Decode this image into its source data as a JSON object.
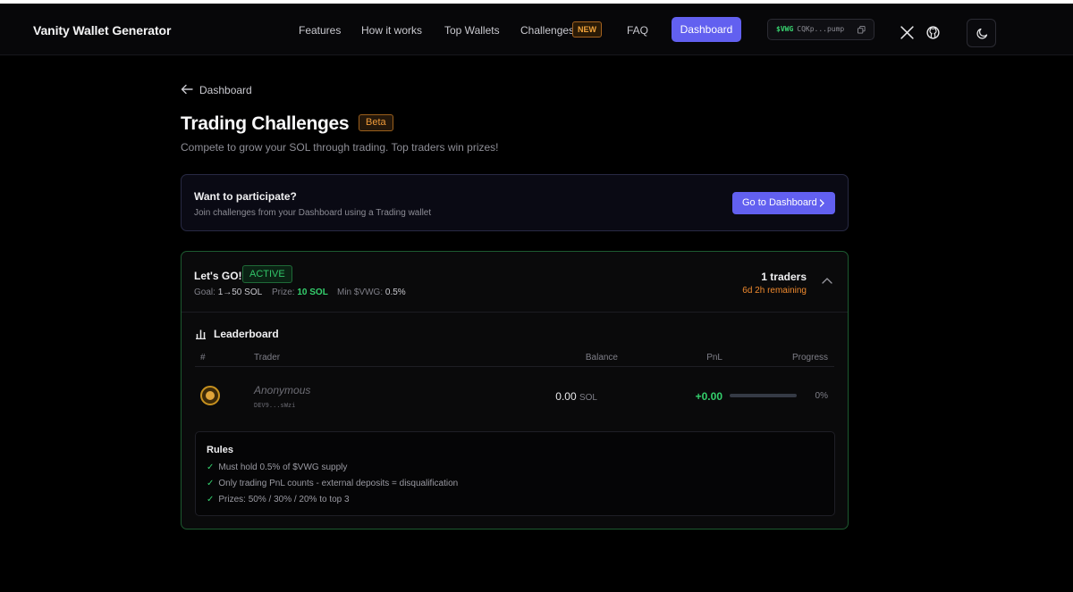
{
  "nav": {
    "brand": "Vanity Wallet Generator",
    "links": [
      "Features",
      "How it works",
      "Top Wallets",
      "Challenges",
      "FAQ"
    ],
    "new_badge": "NEW",
    "dashboard": "Dashboard",
    "token_symbol": "$VWG",
    "token_address": "CQKp...pump"
  },
  "header": {
    "back": "Dashboard",
    "title": "Trading Challenges",
    "beta": "Beta",
    "subtitle": "Compete to grow your SOL through trading. Top traders win prizes!"
  },
  "participate": {
    "title": "Want to participate?",
    "subtitle": "Join challenges from your Dashboard using a Trading wallet",
    "button": "Go to Dashboard"
  },
  "challenge": {
    "name": "Let's GO!",
    "status": "ACTIVE",
    "goal_label": "Goal:",
    "goal_value": "1→50 SOL",
    "prize_label": "Prize:",
    "prize_value": "10 SOL",
    "min_label": "Min $VWG:",
    "min_value": "0.5%",
    "traders": "1 traders",
    "remaining": "6d 2h remaining",
    "leaderboard_title": "Leaderboard",
    "columns": [
      "#",
      "Trader",
      "Balance",
      "PnL",
      "Progress"
    ],
    "rows": [
      {
        "trader": "Anonymous",
        "address": "DEV9...sWzi",
        "balance": "0.00",
        "balance_unit": "SOL",
        "pnl": "+0.00",
        "progress": 0,
        "progress_label": "0%"
      }
    ],
    "rules_title": "Rules",
    "rules": [
      "Must hold 0.5% of $VWG supply",
      "Only trading PnL counts - external deposits = disqualification",
      "Prizes: 50% / 30% / 20% to top 3"
    ],
    "check_glyph": "✓"
  },
  "colors": {
    "accent": "#6260f0",
    "green": "#34d06d",
    "orange": "#f08a2e"
  }
}
